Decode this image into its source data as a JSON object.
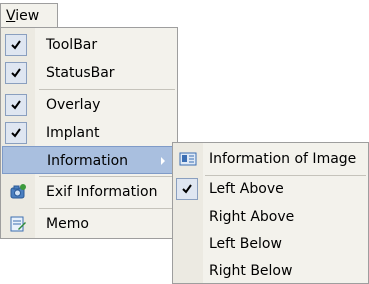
{
  "menubar": {
    "view_label_underlined": "V",
    "view_label_rest": "iew"
  },
  "main_menu": {
    "toolbar": {
      "label": "ToolBar",
      "checked": true
    },
    "statusbar": {
      "label": "StatusBar",
      "checked": true
    },
    "overlay": {
      "label": "Overlay",
      "checked": true
    },
    "implant": {
      "label": "Implant",
      "checked": true
    },
    "information": {
      "label": "Information",
      "has_submenu": true,
      "highlighted": true
    },
    "exif": {
      "label": "Exif Information",
      "icon": "exif-icon"
    },
    "memo": {
      "label": "Memo",
      "icon": "memo-icon"
    }
  },
  "submenu": {
    "info_of_image": {
      "label": "Information of Image",
      "icon": "info-image-icon"
    },
    "left_above": {
      "label": "Left Above",
      "checked": true
    },
    "right_above": {
      "label": "Right Above"
    },
    "left_below": {
      "label": "Left Below"
    },
    "right_below": {
      "label": "Right Below"
    }
  },
  "colors": {
    "menu_bg": "#f3f2ec",
    "gutter_bg": "#eceae2",
    "highlight_bg": "#a9bfdf",
    "check_bg": "#dfe6f1"
  }
}
